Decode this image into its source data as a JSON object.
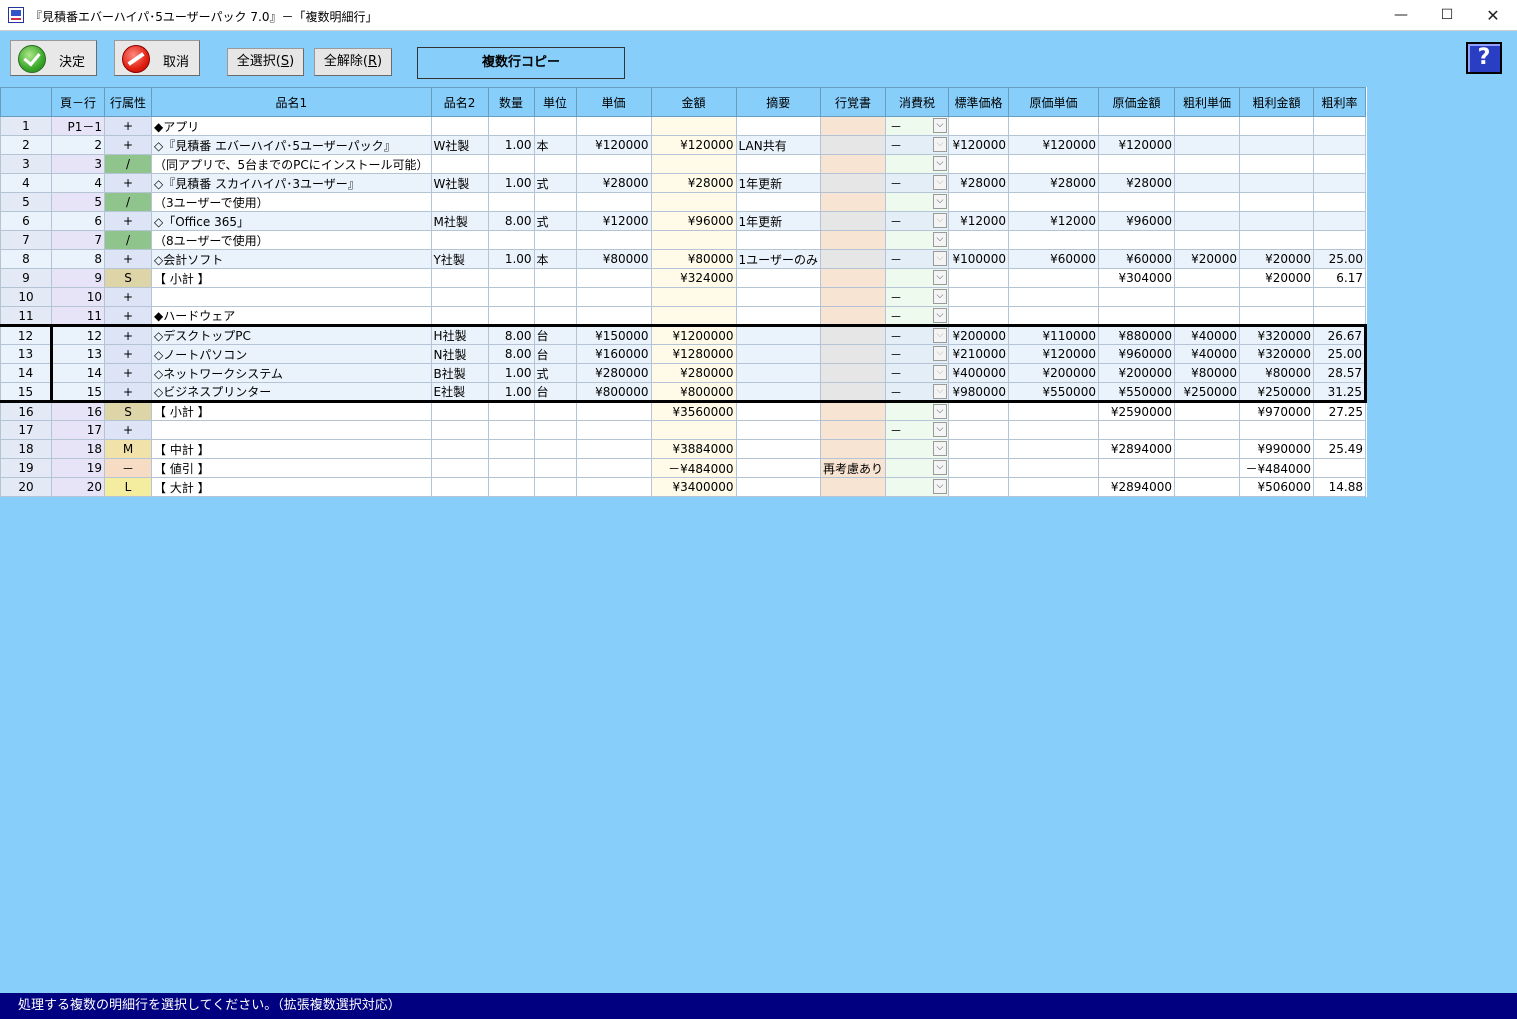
{
  "window": {
    "title": "『見積番エバーハイパ･5ユーザーパック 7.0』－「複数明細行」",
    "min_glyph": "—",
    "max_glyph": "☐",
    "close_glyph": "✕"
  },
  "toolbar": {
    "ok_label": "決定",
    "cancel_label": "取消",
    "select_all_label": "全選択(",
    "select_all_key": "S",
    "deselect_all_label": "全解除(",
    "deselect_all_key": "R",
    "copy_rows_label": "複数行コピー",
    "help_glyph": "?"
  },
  "columns": [
    "",
    "頁－行",
    "行属性",
    "品名1",
    "品名2",
    "数量",
    "単位",
    "単価",
    "金額",
    "摘要",
    "行覚書",
    "消費税",
    "標準価格",
    "原価単価",
    "原価金額",
    "粗利単価",
    "粗利金額",
    "粗利率"
  ],
  "rows": [
    {
      "no": "1",
      "page": "P1－1",
      "attr": "+",
      "attr_color": "#dde4f6",
      "name1": "◆アプリ",
      "name2": "",
      "qty": "",
      "unit": "",
      "price": "",
      "amount": "",
      "memo": "",
      "note": "",
      "tax": "－",
      "std": "",
      "cost_price": "",
      "cost_amount": "",
      "margin_price": "",
      "margin_amount": "",
      "margin_rate": ""
    },
    {
      "no": "2",
      "page": "2",
      "attr": "+",
      "attr_color": "#dde4f6",
      "name1": "◇『見積番 エバーハイパ･5ユーザーパック』",
      "name2": "W社製",
      "qty": "1.00",
      "unit": "本",
      "price": "¥120000",
      "amount": "¥120000",
      "memo": "LAN共有",
      "note": "",
      "tax": "－",
      "std": "¥120000",
      "cost_price": "¥120000",
      "cost_amount": "¥120000",
      "margin_price": "",
      "margin_amount": "",
      "margin_rate": ""
    },
    {
      "no": "3",
      "page": "3",
      "attr": "/",
      "attr_color": "#8fc48c",
      "name1": "（同アプリで、5台までのPCにインストール可能）",
      "name2": "",
      "qty": "",
      "unit": "",
      "price": "",
      "amount": "",
      "memo": "",
      "note": "",
      "tax": "",
      "std": "",
      "cost_price": "",
      "cost_amount": "",
      "margin_price": "",
      "margin_amount": "",
      "margin_rate": ""
    },
    {
      "no": "4",
      "page": "4",
      "attr": "+",
      "attr_color": "#dde4f6",
      "name1": "◇『見積番 スカイハイパ･3ユーザー』",
      "name2": "W社製",
      "qty": "1.00",
      "unit": "式",
      "price": "¥28000",
      "amount": "¥28000",
      "memo": "1年更新",
      "note": "",
      "tax": "－",
      "std": "¥28000",
      "cost_price": "¥28000",
      "cost_amount": "¥28000",
      "margin_price": "",
      "margin_amount": "",
      "margin_rate": ""
    },
    {
      "no": "5",
      "page": "5",
      "attr": "/",
      "attr_color": "#8fc48c",
      "name1": "（3ユーザーで使用）",
      "name2": "",
      "qty": "",
      "unit": "",
      "price": "",
      "amount": "",
      "memo": "",
      "note": "",
      "tax": "",
      "std": "",
      "cost_price": "",
      "cost_amount": "",
      "margin_price": "",
      "margin_amount": "",
      "margin_rate": ""
    },
    {
      "no": "6",
      "page": "6",
      "attr": "+",
      "attr_color": "#dde4f6",
      "name1": "◇「Office 365」",
      "name2": "M社製",
      "qty": "8.00",
      "unit": "式",
      "price": "¥12000",
      "amount": "¥96000",
      "memo": "1年更新",
      "note": "",
      "tax": "－",
      "std": "¥12000",
      "cost_price": "¥12000",
      "cost_amount": "¥96000",
      "margin_price": "",
      "margin_amount": "",
      "margin_rate": ""
    },
    {
      "no": "7",
      "page": "7",
      "attr": "/",
      "attr_color": "#8fc48c",
      "name1": "（8ユーザーで使用）",
      "name2": "",
      "qty": "",
      "unit": "",
      "price": "",
      "amount": "",
      "memo": "",
      "note": "",
      "tax": "",
      "std": "",
      "cost_price": "",
      "cost_amount": "",
      "margin_price": "",
      "margin_amount": "",
      "margin_rate": ""
    },
    {
      "no": "8",
      "page": "8",
      "attr": "+",
      "attr_color": "#dde4f6",
      "name1": "◇会計ソフト",
      "name2": "Y社製",
      "qty": "1.00",
      "unit": "本",
      "price": "¥80000",
      "amount": "¥80000",
      "memo": "1ユーザーのみ",
      "note": "",
      "tax": "－",
      "std": "¥100000",
      "cost_price": "¥60000",
      "cost_amount": "¥60000",
      "margin_price": "¥20000",
      "margin_amount": "¥20000",
      "margin_rate": "25.00"
    },
    {
      "no": "9",
      "page": "9",
      "attr": "S",
      "attr_color": "#ddd4a8",
      "name1": "【 小計 】",
      "name2": "",
      "qty": "",
      "unit": "",
      "price": "",
      "amount": "¥324000",
      "memo": "",
      "note": "",
      "tax": "",
      "std": "",
      "cost_price": "",
      "cost_amount": "¥304000",
      "margin_price": "",
      "margin_amount": "¥20000",
      "margin_rate": "6.17"
    },
    {
      "no": "10",
      "page": "10",
      "attr": "+",
      "attr_color": "#dde4f6",
      "name1": "",
      "name2": "",
      "qty": "",
      "unit": "",
      "price": "",
      "amount": "",
      "memo": "",
      "note": "",
      "tax": "－",
      "std": "",
      "cost_price": "",
      "cost_amount": "",
      "margin_price": "",
      "margin_amount": "",
      "margin_rate": ""
    },
    {
      "no": "11",
      "page": "11",
      "attr": "+",
      "attr_color": "#dde4f6",
      "name1": "◆ハードウェア",
      "name2": "",
      "qty": "",
      "unit": "",
      "price": "",
      "amount": "",
      "memo": "",
      "note": "",
      "tax": "－",
      "std": "",
      "cost_price": "",
      "cost_amount": "",
      "margin_price": "",
      "margin_amount": "",
      "margin_rate": ""
    },
    {
      "no": "12",
      "page": "12",
      "attr": "+",
      "attr_color": "#dde4f6",
      "name1": "◇デスクトップPC",
      "name2": "H社製",
      "qty": "8.00",
      "unit": "台",
      "price": "¥150000",
      "amount": "¥1200000",
      "memo": "",
      "note": "",
      "tax": "－",
      "std": "¥200000",
      "cost_price": "¥110000",
      "cost_amount": "¥880000",
      "margin_price": "¥40000",
      "margin_amount": "¥320000",
      "margin_rate": "26.67"
    },
    {
      "no": "13",
      "page": "13",
      "attr": "+",
      "attr_color": "#dde4f6",
      "name1": "◇ノートパソコン",
      "name2": "N社製",
      "qty": "8.00",
      "unit": "台",
      "price": "¥160000",
      "amount": "¥1280000",
      "memo": "",
      "note": "",
      "tax": "－",
      "std": "¥210000",
      "cost_price": "¥120000",
      "cost_amount": "¥960000",
      "margin_price": "¥40000",
      "margin_amount": "¥320000",
      "margin_rate": "25.00"
    },
    {
      "no": "14",
      "page": "14",
      "attr": "+",
      "attr_color": "#dde4f6",
      "name1": "◇ネットワークシステム",
      "name2": "B社製",
      "qty": "1.00",
      "unit": "式",
      "price": "¥280000",
      "amount": "¥280000",
      "memo": "",
      "note": "",
      "tax": "－",
      "std": "¥400000",
      "cost_price": "¥200000",
      "cost_amount": "¥200000",
      "margin_price": "¥80000",
      "margin_amount": "¥80000",
      "margin_rate": "28.57"
    },
    {
      "no": "15",
      "page": "15",
      "attr": "+",
      "attr_color": "#dde4f6",
      "name1": "◇ビジネスプリンター",
      "name2": "E社製",
      "qty": "1.00",
      "unit": "台",
      "price": "¥800000",
      "amount": "¥800000",
      "memo": "",
      "note": "",
      "tax": "－",
      "std": "¥980000",
      "cost_price": "¥550000",
      "cost_amount": "¥550000",
      "margin_price": "¥250000",
      "margin_amount": "¥250000",
      "margin_rate": "31.25"
    },
    {
      "no": "16",
      "page": "16",
      "attr": "S",
      "attr_color": "#ddd4a8",
      "name1": "【 小計 】",
      "name2": "",
      "qty": "",
      "unit": "",
      "price": "",
      "amount": "¥3560000",
      "memo": "",
      "note": "",
      "tax": "",
      "std": "",
      "cost_price": "",
      "cost_amount": "¥2590000",
      "margin_price": "",
      "margin_amount": "¥970000",
      "margin_rate": "27.25"
    },
    {
      "no": "17",
      "page": "17",
      "attr": "+",
      "attr_color": "#dde4f6",
      "name1": "",
      "name2": "",
      "qty": "",
      "unit": "",
      "price": "",
      "amount": "",
      "memo": "",
      "note": "",
      "tax": "－",
      "std": "",
      "cost_price": "",
      "cost_amount": "",
      "margin_price": "",
      "margin_amount": "",
      "margin_rate": ""
    },
    {
      "no": "18",
      "page": "18",
      "attr": "M",
      "attr_color": "#f0e2a8",
      "name1": "【 中計 】",
      "name2": "",
      "qty": "",
      "unit": "",
      "price": "",
      "amount": "¥3884000",
      "memo": "",
      "note": "",
      "tax": "",
      "std": "",
      "cost_price": "",
      "cost_amount": "¥2894000",
      "margin_price": "",
      "margin_amount": "¥990000",
      "margin_rate": "25.49"
    },
    {
      "no": "19",
      "page": "19",
      "attr": "－",
      "attr_color": "#f6dcc4",
      "name1": "【 値引 】",
      "name2": "",
      "qty": "",
      "unit": "",
      "price": "",
      "amount": "－¥484000",
      "memo": "",
      "note": "再考慮あり",
      "tax": "",
      "std": "",
      "cost_price": "",
      "cost_amount": "",
      "margin_price": "",
      "margin_amount": "－¥484000",
      "margin_rate": ""
    },
    {
      "no": "20",
      "page": "20",
      "attr": "L",
      "attr_color": "#f4ec9e",
      "name1": "【 大計 】",
      "name2": "",
      "qty": "",
      "unit": "",
      "price": "",
      "amount": "¥3400000",
      "memo": "",
      "note": "",
      "tax": "",
      "std": "",
      "cost_price": "",
      "cost_amount": "¥2894000",
      "margin_price": "",
      "margin_amount": "¥506000",
      "margin_rate": "14.88"
    }
  ],
  "selected_rows": [
    "12",
    "13",
    "14",
    "15"
  ],
  "status": {
    "message": "処理する複数の明細行を選択してください。（拡張複数選択対応）"
  },
  "colors": {
    "background": "#87CEFA",
    "status_bar": "#000080",
    "selection_border": "#000000"
  }
}
